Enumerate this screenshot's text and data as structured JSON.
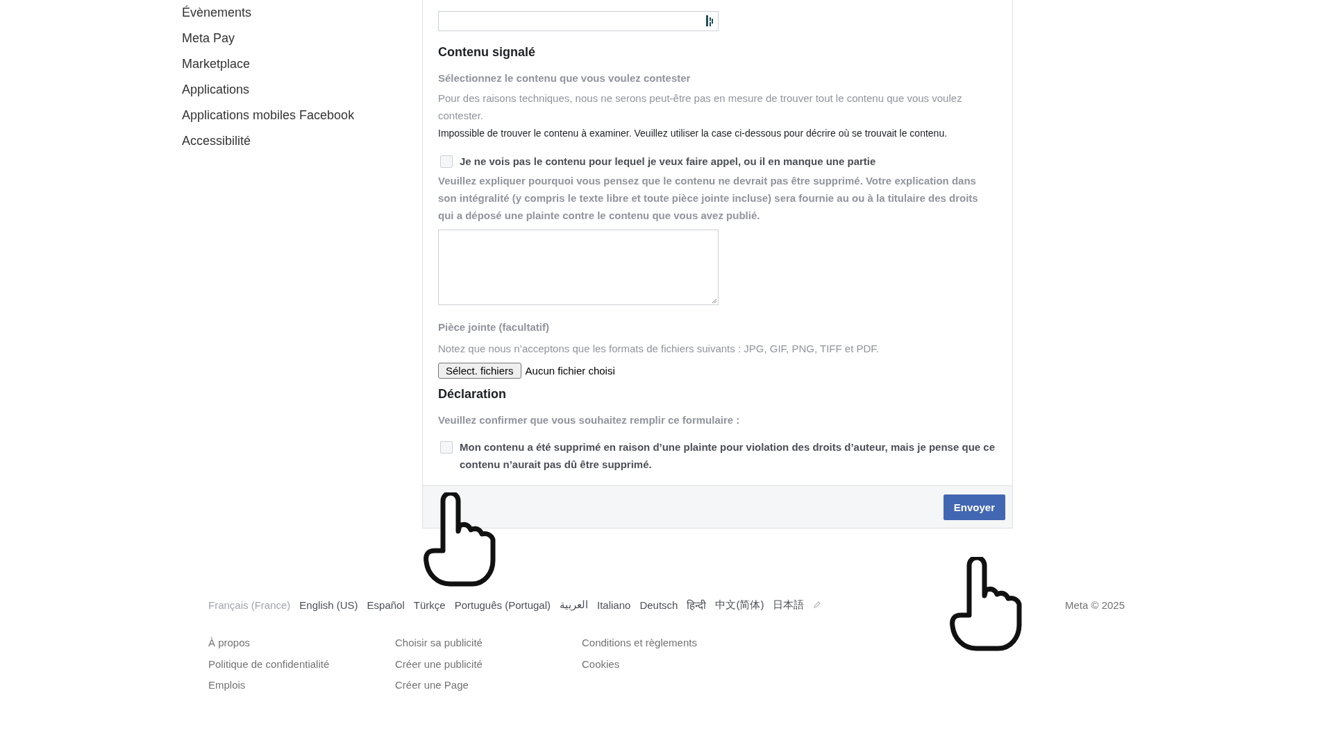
{
  "sidebar": {
    "items": [
      {
        "label": "Évènements"
      },
      {
        "label": "Meta Pay"
      },
      {
        "label": "Marketplace"
      },
      {
        "label": "Applications"
      },
      {
        "label": "Applications mobiles Facebook"
      },
      {
        "label": "Accessibilité"
      }
    ]
  },
  "form": {
    "reported": {
      "title": "Contenu signalé",
      "subtitle": "Sélectionnez le contenu que vous voulez contester",
      "note": "Pour des raisons techniques, nous ne serons peut-être pas en mesure de trouver tout le contenu que vous voulez contester.",
      "error": "Impossible de trouver le contenu à examiner. Veuillez utiliser la case ci-dessous pour décrire où se trouvait le contenu.",
      "checkbox": {
        "label": "Je ne vois pas le contenu pour lequel je veux faire appel, ou il en manque une partie",
        "checked": false
      },
      "explain": "Veuillez expliquer pourquoi vous pensez que le contenu ne devrait pas être supprimé. Votre explication dans son intégralité (y compris le texte libre et toute pièce jointe incluse) sera fournie au ou à la titulaire des droits qui a déposé une plainte contre le contenu que vous avez publié."
    },
    "attachment": {
      "label": "Pièce jointe (facultatif)",
      "note": "Notez que nous n’acceptons que les formats de fichiers suivants : JPG, GIF, PNG, TIFF et PDF.",
      "button": "Sélect. fichiers",
      "status": "Aucun fichier choisi"
    },
    "declaration": {
      "title": "Déclaration",
      "subtitle": "Veuillez confirmer que vous souhaitez remplir ce formulaire :",
      "checkbox": {
        "label": "Mon contenu a été supprimé en raison d’une plainte pour violation des droits d’auteur, mais je pense que ce contenu n’aurait pas dû être supprimé.",
        "checked": false
      }
    },
    "submit": "Envoyer"
  },
  "footer": {
    "languages": [
      {
        "label": "Français (France)",
        "selected": true
      },
      {
        "label": "English (US)",
        "selected": false
      },
      {
        "label": "Español",
        "selected": false
      },
      {
        "label": "Türkçe",
        "selected": false
      },
      {
        "label": "Português (Portugal)",
        "selected": false
      },
      {
        "label": "العربية",
        "selected": false
      },
      {
        "label": "Italiano",
        "selected": false
      },
      {
        "label": "Deutsch",
        "selected": false
      },
      {
        "label": "हिन्दी",
        "selected": false
      },
      {
        "label": "中文(简体)",
        "selected": false
      },
      {
        "label": "日本語",
        "selected": false
      }
    ],
    "copyright": "Meta © 2025",
    "link_columns": [
      [
        "À propos",
        "Politique de confidentialité",
        "Emplois"
      ],
      [
        "Choisir sa publicité",
        "Créer une publicité",
        "Créer une Page"
      ],
      [
        "Conditions et règlements",
        "Cookies"
      ]
    ]
  }
}
